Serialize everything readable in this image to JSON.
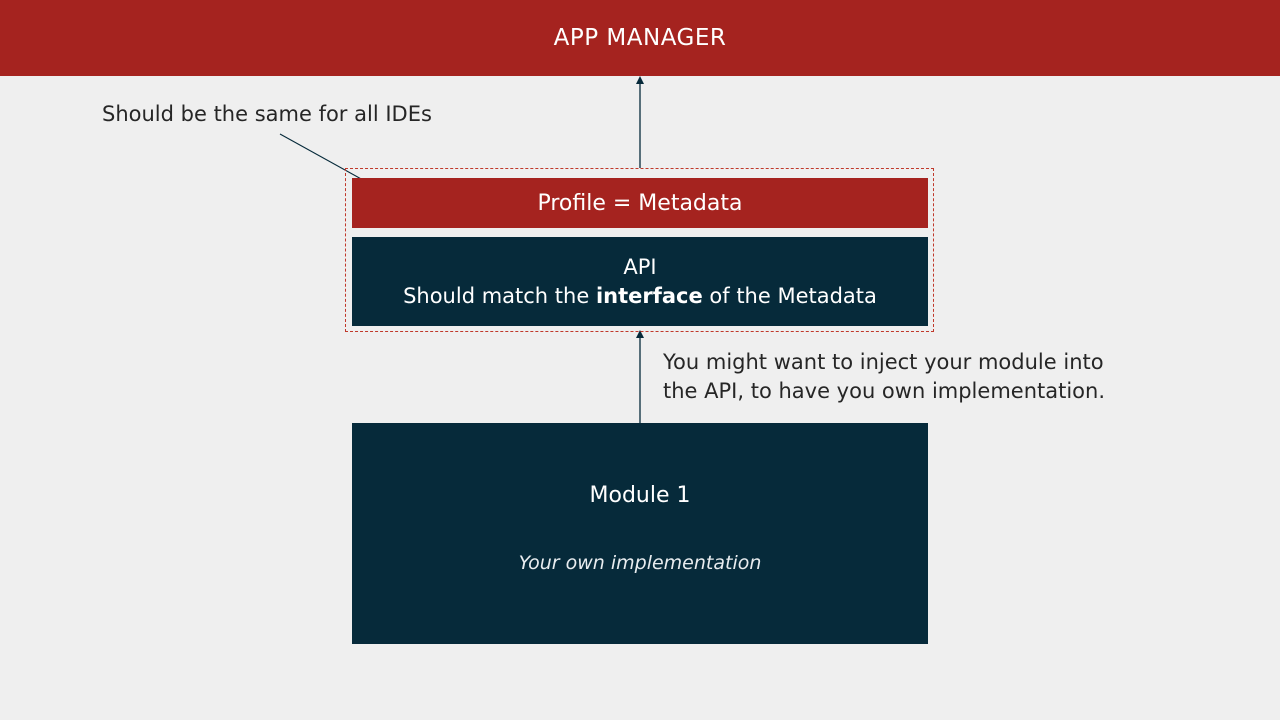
{
  "header": {
    "title": "APP MANAGER"
  },
  "notes": {
    "top": "Should be the same for all IDEs",
    "right_line1": "You might want to inject your module into",
    "right_line2": "the API, to have you own implementation."
  },
  "profile": {
    "label": "Profile = Metadata"
  },
  "api": {
    "title": "API",
    "line2_before": "Should match the ",
    "line2_bold": "interface",
    "line2_after": " of the Metadata"
  },
  "module": {
    "title": "Module 1",
    "subtitle": "Your own implementation"
  },
  "colors": {
    "brand_red": "#a5231f",
    "dark_navy": "#062a3a",
    "background": "#efefef",
    "connector": "#062a3a"
  }
}
